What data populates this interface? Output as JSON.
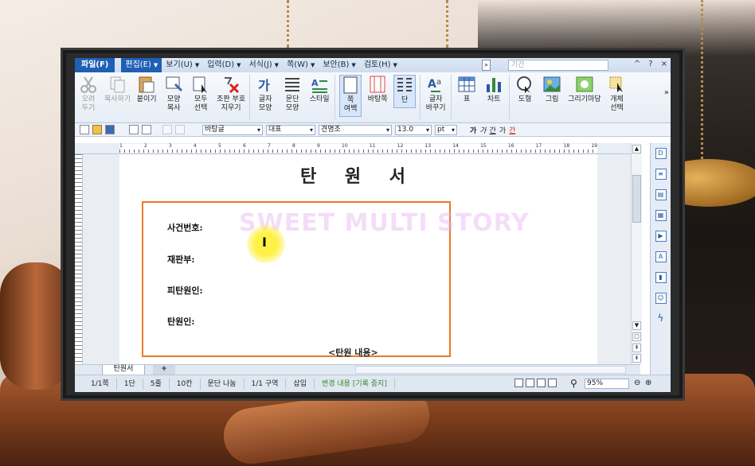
{
  "menu": {
    "file": "파일(F)",
    "items": [
      "편집(E)",
      "보기(U)",
      "입력(D)",
      "서식(J)",
      "쪽(W)",
      "보안(B)",
      "검토(H)"
    ],
    "search_placeholder": "기간",
    "window_controls": [
      "^",
      "?",
      "×"
    ]
  },
  "ribbon": {
    "buttons": [
      {
        "label": "오려\n두기",
        "icon": "scissors-icon",
        "enabled": false
      },
      {
        "label": "복사하기",
        "icon": "copy-icon",
        "enabled": false
      },
      {
        "label": "붙이기",
        "icon": "paste-icon",
        "enabled": true
      },
      {
        "label": "모양\n복사",
        "icon": "format-painter-icon",
        "enabled": true
      },
      {
        "label": "모두\n선택",
        "icon": "select-all-icon",
        "enabled": true
      },
      {
        "label": "조판 부호\n지우기",
        "icon": "clear-marks-icon",
        "enabled": true
      },
      {
        "label": "글자\n모양",
        "icon": "char-shape-icon",
        "enabled": true
      },
      {
        "label": "문단\n모양",
        "icon": "para-shape-icon",
        "enabled": true
      },
      {
        "label": "스타일",
        "icon": "style-icon",
        "enabled": true
      },
      {
        "label": "쪽\n여백",
        "icon": "page-margin-icon",
        "enabled": true
      },
      {
        "label": "바탕쪽",
        "icon": "master-page-icon",
        "enabled": true
      },
      {
        "label": "단",
        "icon": "column-icon",
        "enabled": true
      },
      {
        "label": "글자\n바꾸기",
        "icon": "char-replace-icon",
        "enabled": true
      },
      {
        "label": "표",
        "icon": "table-icon",
        "enabled": true
      },
      {
        "label": "차트",
        "icon": "chart-icon",
        "enabled": true
      },
      {
        "label": "도형",
        "icon": "shape-icon",
        "enabled": true
      },
      {
        "label": "그림",
        "icon": "picture-icon",
        "enabled": true
      },
      {
        "label": "그리기마당",
        "icon": "clipart-icon",
        "enabled": true
      },
      {
        "label": "개체\n선택",
        "icon": "object-select-icon",
        "enabled": true
      }
    ]
  },
  "format_toolbar": {
    "style": "바탕글",
    "language": "대표",
    "font": "견명조",
    "size": "13.0",
    "unit": "pt",
    "bold": "가",
    "italic": "가",
    "underline": "간",
    "strike": "가",
    "color_letter": "간"
  },
  "document": {
    "title": "탄 원 서",
    "fields": [
      "사건번호:",
      "재판부:",
      "피탄원인:",
      "탄원인:"
    ],
    "section_heading": "<탄원 내용>",
    "watermark": "SWEET MULTI STORY"
  },
  "ruler_ticks": [
    "1",
    "2",
    "3",
    "4",
    "5",
    "6",
    "7",
    "8",
    "9",
    "10",
    "11",
    "12",
    "13",
    "14",
    "15",
    "16",
    "17",
    "18",
    "19"
  ],
  "tabs": {
    "active": "탄원서",
    "add": "+"
  },
  "status": {
    "page": "1/1쪽",
    "column": "1단",
    "line": "5줄",
    "char": "10칸",
    "para_break": "문단 나눔",
    "section": "1/1 구역",
    "insert_mode": "삽입",
    "track_changes": "변경 내용 [기록 중지]",
    "zoom": "95%"
  },
  "colors": {
    "accent": "#1f5fb4",
    "box_border": "#e8792a",
    "status_green": "#3a8a2a"
  }
}
